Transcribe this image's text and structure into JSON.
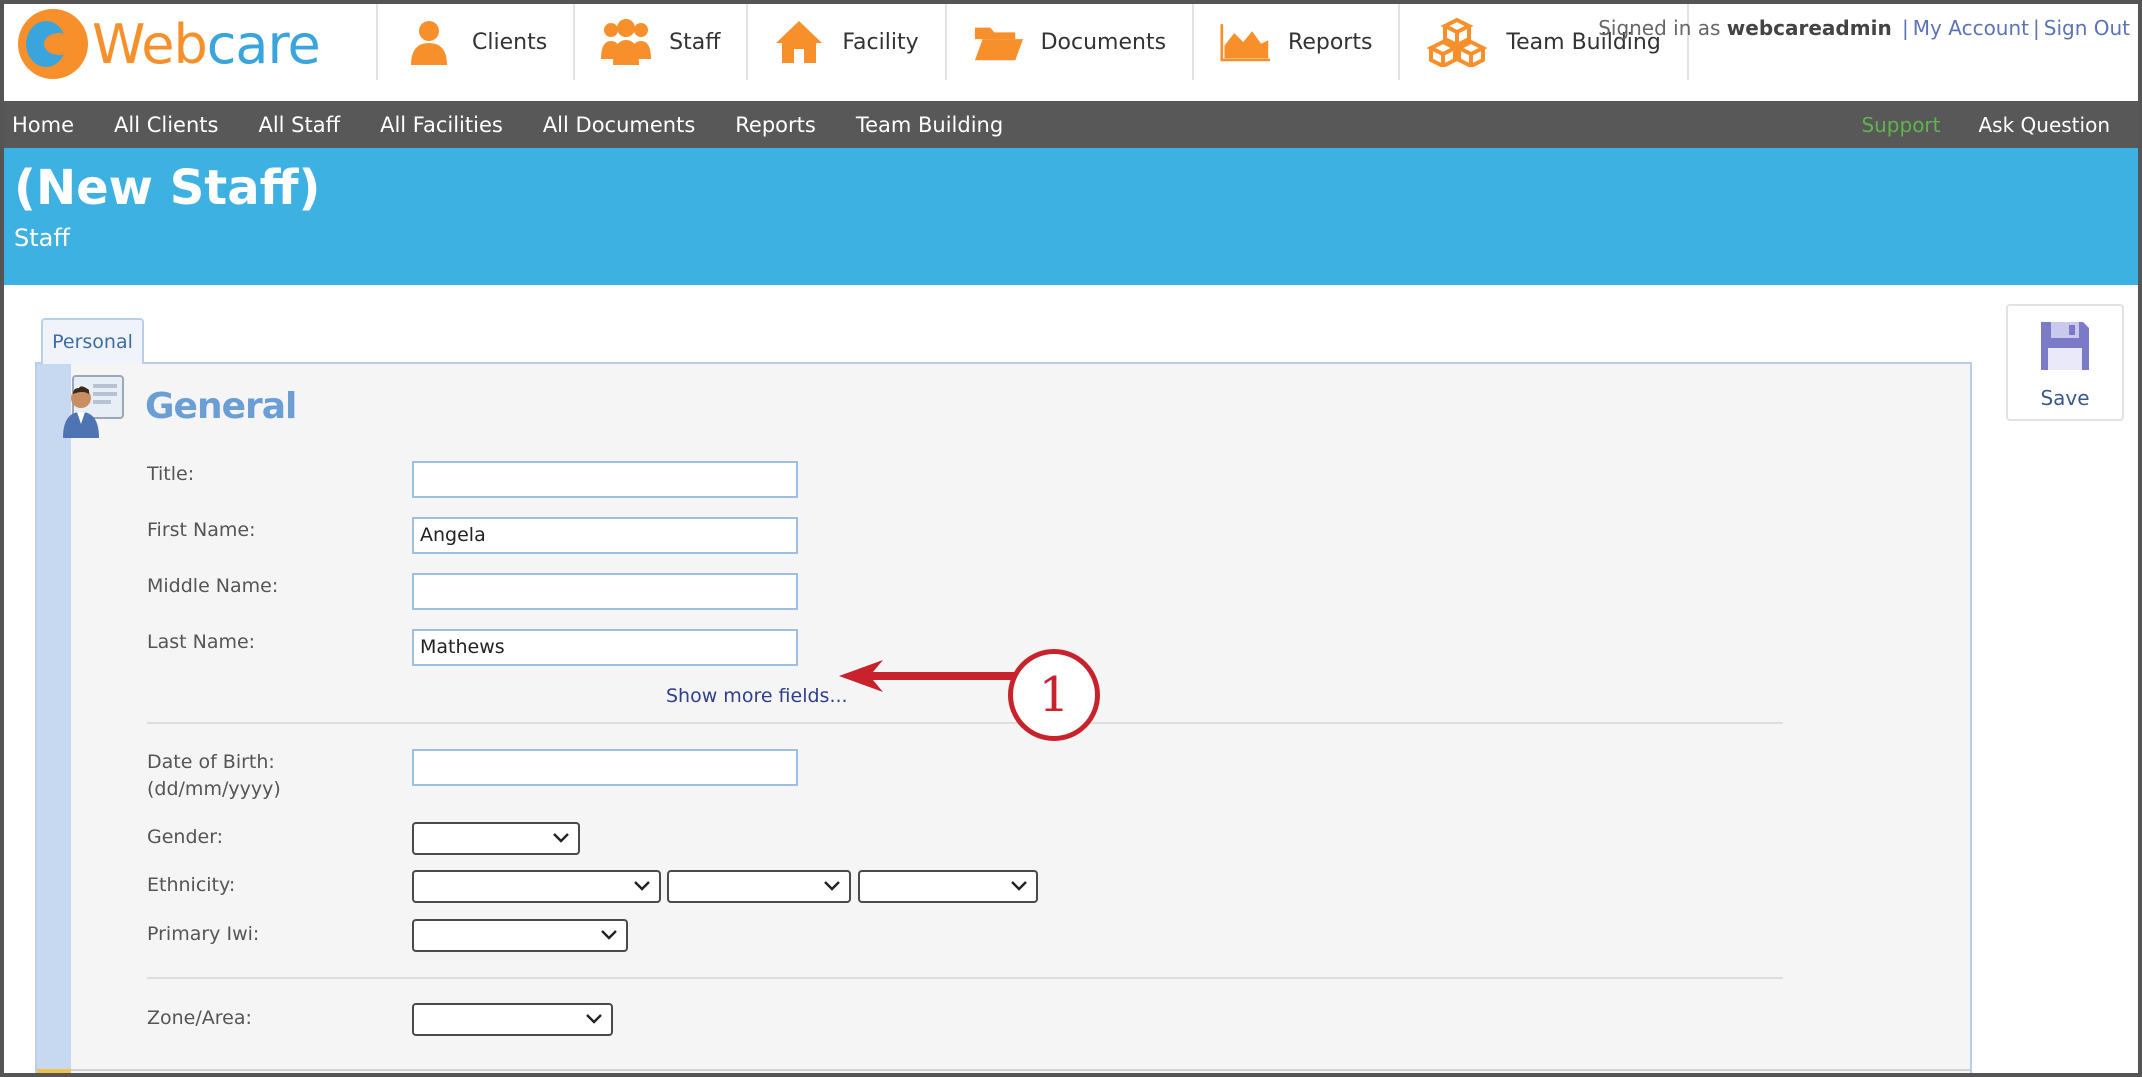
{
  "logo": {
    "text_a": "Web",
    "text_b": "care"
  },
  "top_nav": [
    {
      "label": "Clients",
      "icon": "person-icon"
    },
    {
      "label": "Staff",
      "icon": "group-icon"
    },
    {
      "label": "Facility",
      "icon": "house-icon"
    },
    {
      "label": "Documents",
      "icon": "folder-icon"
    },
    {
      "label": "Reports",
      "icon": "area-chart-icon"
    },
    {
      "label": "Team Building",
      "icon": "boxes-icon"
    }
  ],
  "account": {
    "signed_in_prefix": "Signed in as",
    "username": "webcareadmin",
    "my_account": "My Account",
    "separator": "|",
    "sign_out": "Sign Out"
  },
  "sub_nav": {
    "items": [
      "Home",
      "All Clients",
      "All Staff",
      "All Facilities",
      "All Documents",
      "Reports",
      "Team Building"
    ],
    "support": "Support",
    "ask_question": "Ask Question"
  },
  "banner": {
    "title": "(New Staff)",
    "subtitle": "Staff"
  },
  "tab": {
    "label": "Personal"
  },
  "section": {
    "title": "General"
  },
  "form": {
    "title_label": "Title:",
    "title_value": "",
    "first_name_label": "First Name:",
    "first_name_value": "Angela",
    "middle_name_label": "Middle Name:",
    "middle_name_value": "",
    "last_name_label": "Last Name:",
    "last_name_value": "Mathews",
    "show_more": "Show more fields...",
    "dob_label": "Date of Birth:",
    "dob_format": "(dd/mm/yyyy)",
    "dob_value": "",
    "gender_label": "Gender:",
    "ethnicity_label": "Ethnicity:",
    "primary_iwi_label": "Primary Iwi:",
    "zone_label": "Zone/Area:"
  },
  "callout": {
    "number": "1"
  },
  "save": {
    "label": "Save"
  },
  "colors": {
    "brand_orange": "#f7902a",
    "brand_blue": "#3eb1e3",
    "nav_grey": "#585858",
    "callout_red": "#c8232c",
    "section_title": "#6a9fd5"
  }
}
